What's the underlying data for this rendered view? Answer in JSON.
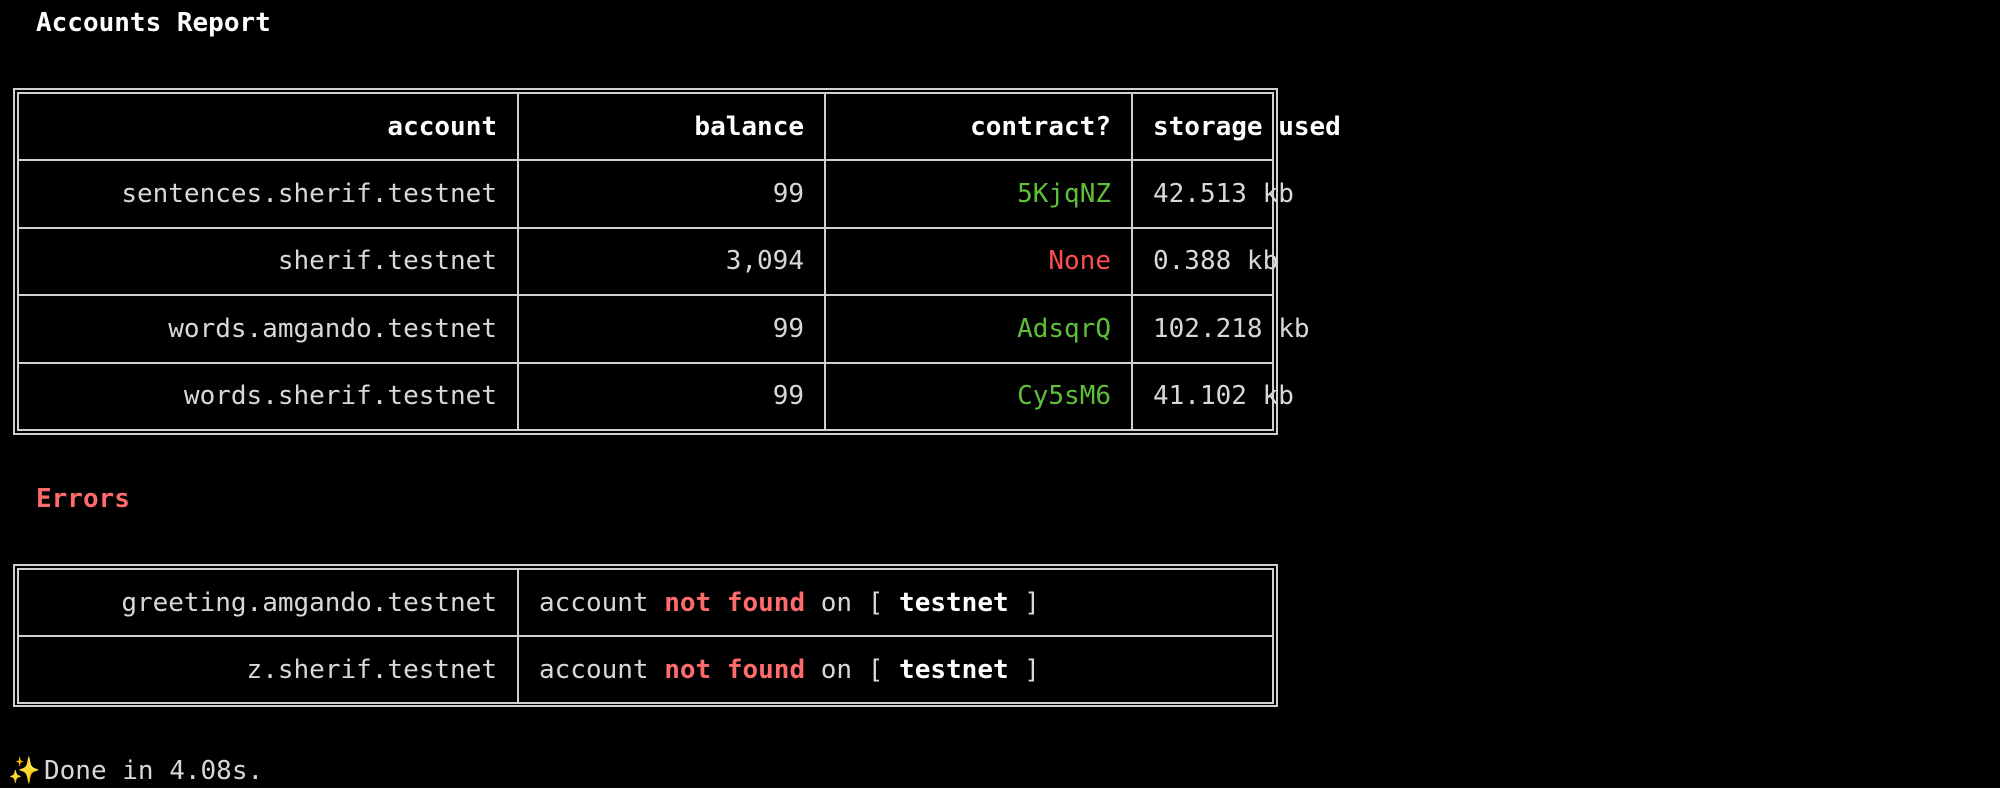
{
  "report": {
    "title": "Accounts Report",
    "headers": {
      "account": "account",
      "balance": "balance",
      "contract": "contract?",
      "storage": "storage used"
    },
    "rows": [
      {
        "account": "sentences.sherif.testnet",
        "balance": "99",
        "contract": "5KjqNZ",
        "contract_status": "green",
        "storage": "42.513 kb"
      },
      {
        "account": "sherif.testnet",
        "balance": "3,094",
        "contract": "None",
        "contract_status": "red",
        "storage": "0.388 kb"
      },
      {
        "account": "words.amgando.testnet",
        "balance": "99",
        "contract": "AdsqrQ",
        "contract_status": "green",
        "storage": "102.218 kb"
      },
      {
        "account": "words.sherif.testnet",
        "balance": "99",
        "contract": "Cy5sM6",
        "contract_status": "green",
        "storage": "41.102 kb"
      }
    ]
  },
  "errors": {
    "title": "Errors",
    "rows": [
      {
        "account": "greeting.amgando.testnet",
        "msg_prefix": "account ",
        "msg_highlight": "not found",
        "msg_mid": " on [ ",
        "network": "testnet",
        "msg_suffix": " ]"
      },
      {
        "account": "z.sherif.testnet",
        "msg_prefix": "account ",
        "msg_highlight": "not found",
        "msg_mid": " on [ ",
        "network": "testnet",
        "msg_suffix": " ]"
      }
    ]
  },
  "footer": {
    "icon": "sparkles-icon",
    "text": "Done in 4.08s."
  },
  "colors": {
    "background": "#000000",
    "contract_ok": "#5fbf3a",
    "contract_none": "#ff4d4d",
    "error_accent": "#ff6b6b"
  }
}
